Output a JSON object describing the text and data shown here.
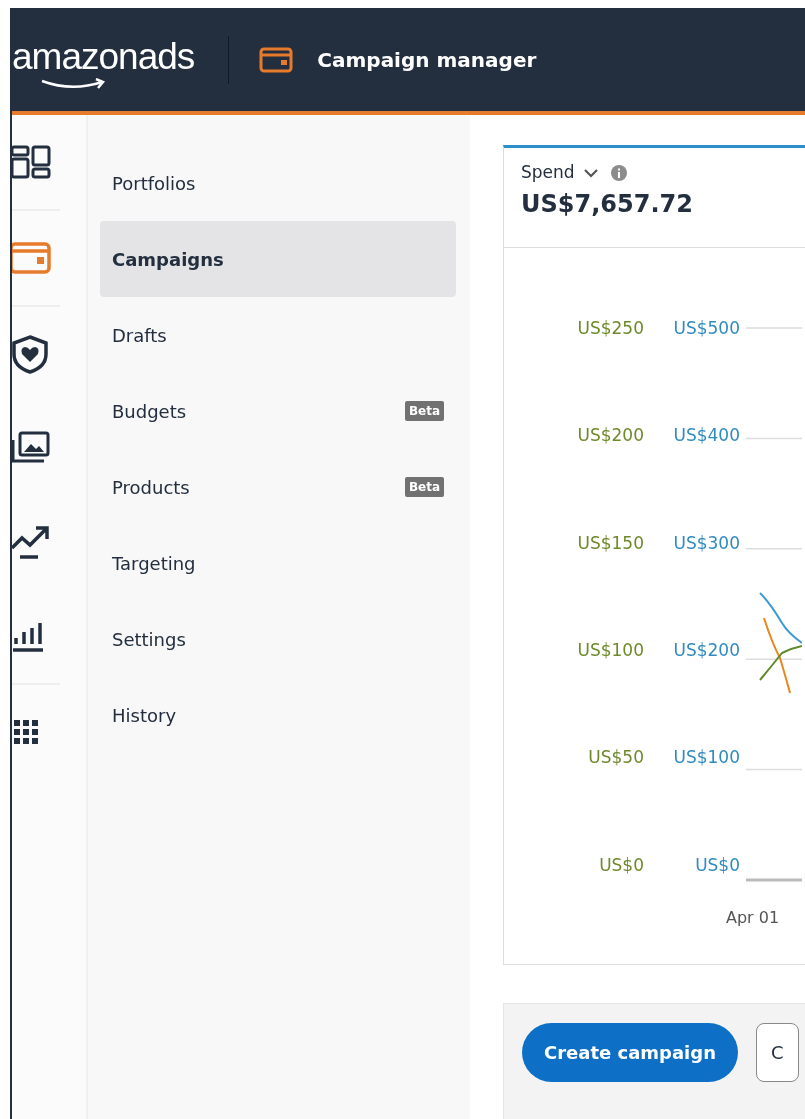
{
  "header": {
    "logo": "amazonads",
    "title": "Campaign manager"
  },
  "rail": [
    {
      "kind": "dashboard",
      "active": false
    },
    {
      "kind": "divider"
    },
    {
      "kind": "wallet",
      "active": true
    },
    {
      "kind": "divider"
    },
    {
      "kind": "shield",
      "active": false
    },
    {
      "kind": "image",
      "active": false
    },
    {
      "kind": "trend",
      "active": false
    },
    {
      "kind": "bars",
      "active": false
    },
    {
      "kind": "divider"
    },
    {
      "kind": "apps",
      "active": false
    }
  ],
  "nav": [
    {
      "label": "Portfolios",
      "selected": false
    },
    {
      "label": "Campaigns",
      "selected": true
    },
    {
      "label": "Drafts",
      "selected": false
    },
    {
      "label": "Budgets",
      "selected": false,
      "badge": "Beta"
    },
    {
      "label": "Products",
      "selected": false,
      "badge": "Beta"
    },
    {
      "label": "Targeting",
      "selected": false
    },
    {
      "label": "Settings",
      "selected": false
    },
    {
      "label": "History",
      "selected": false
    }
  ],
  "metric": {
    "label": "Spend",
    "value": "US$7,657.72"
  },
  "chart": {
    "left_axis": [
      "US$250",
      "US$200",
      "US$150",
      "US$100",
      "US$50",
      "US$0"
    ],
    "right_axis": [
      "US$500",
      "US$400",
      "US$300",
      "US$200",
      "US$100",
      "US$0"
    ],
    "x_label": "Apr 01"
  },
  "actions": [
    {
      "label": "Create campaign",
      "kind": "primary"
    },
    {
      "label": "C",
      "kind": "secondary"
    }
  ]
}
